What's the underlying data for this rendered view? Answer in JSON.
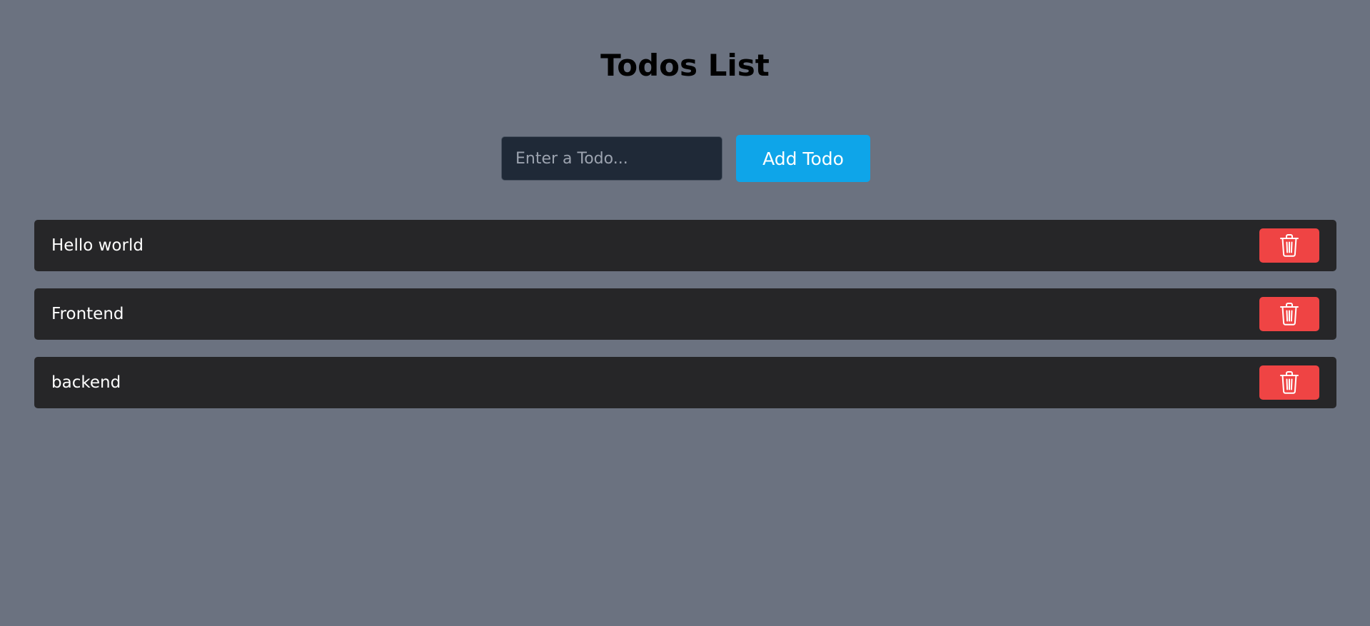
{
  "header": {
    "title": "Todos List"
  },
  "form": {
    "input_value": "",
    "input_placeholder": "Enter a Todo...",
    "add_label": "Add Todo"
  },
  "todos": [
    {
      "text": "Hello world",
      "delete_icon": "trash-icon"
    },
    {
      "text": "Frontend",
      "delete_icon": "trash-icon"
    },
    {
      "text": "backend",
      "delete_icon": "trash-icon"
    }
  ],
  "colors": {
    "background": "#6b7280",
    "input_bg": "#1f2937",
    "add_button": "#0ea5e9",
    "todo_bg": "#262628",
    "delete_button": "#ef4444"
  }
}
